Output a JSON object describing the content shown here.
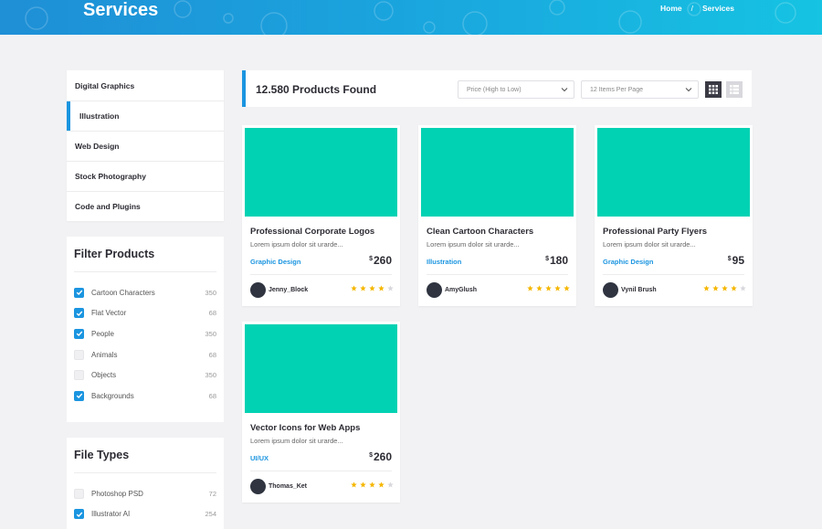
{
  "header": {
    "title": "Services",
    "breadcrumb": {
      "home": "Home",
      "separator": "/",
      "current": "Services"
    },
    "colors": {
      "gradient_start": "#1f8fd6",
      "gradient_end": "#16c3e2"
    }
  },
  "sidebar": {
    "categories": [
      {
        "label": "Digital Graphics",
        "active": false
      },
      {
        "label": "Illustration",
        "active": true
      },
      {
        "label": "Web Design",
        "active": false
      },
      {
        "label": "Stock Photography",
        "active": false
      },
      {
        "label": "Code and Plugins",
        "active": false
      }
    ],
    "filter_products": {
      "title": "Filter Products",
      "items": [
        {
          "label": "Cartoon Characters",
          "count": "350",
          "checked": true
        },
        {
          "label": "Flat Vector",
          "count": "68",
          "checked": true
        },
        {
          "label": "People",
          "count": "350",
          "checked": true
        },
        {
          "label": "Animals",
          "count": "68",
          "checked": false
        },
        {
          "label": "Objects",
          "count": "350",
          "checked": false
        },
        {
          "label": "Backgrounds",
          "count": "68",
          "checked": true
        }
      ]
    },
    "file_types": {
      "title": "File Types",
      "items": [
        {
          "label": "Photoshop PSD",
          "count": "72",
          "checked": false
        },
        {
          "label": "Illustrator AI",
          "count": "254",
          "checked": true
        }
      ]
    }
  },
  "toolbar": {
    "found_text": "12.580 Products Found",
    "sort_value": "Price (High to Low)",
    "per_page_value": "12 Items Per Page",
    "accent": "#1b95e0"
  },
  "products": [
    {
      "title": "Professional Corporate Logos",
      "desc": "Lorem ipsum dolor sit urarde...",
      "category": "Graphic Design",
      "currency": "$",
      "price": "260",
      "author": "Jenny_Block",
      "rating": 4,
      "max_rating": 5
    },
    {
      "title": "Clean Cartoon Characters",
      "desc": "Lorem ipsum dolor sit urarde...",
      "category": "Illustration",
      "currency": "$",
      "price": "180",
      "author": "AmyGlush",
      "rating": 5,
      "max_rating": 5
    },
    {
      "title": "Professional Party Flyers",
      "desc": "Lorem ipsum dolor sit urarde...",
      "category": "Graphic Design",
      "currency": "$",
      "price": "95",
      "author": "Vynil Brush",
      "rating": 4,
      "max_rating": 5
    },
    {
      "title": "Vector Icons for Web Apps",
      "desc": "Lorem ipsum dolor sit urarde...",
      "category": "UI/UX",
      "currency": "$",
      "price": "260",
      "author": "Thomas_Ket",
      "rating": 4,
      "max_rating": 5
    }
  ],
  "colors": {
    "thumb": "#00d2b3",
    "star_on": "#f5b700",
    "star_off": "#d8d8dd",
    "check_on": "#1b95e0"
  }
}
